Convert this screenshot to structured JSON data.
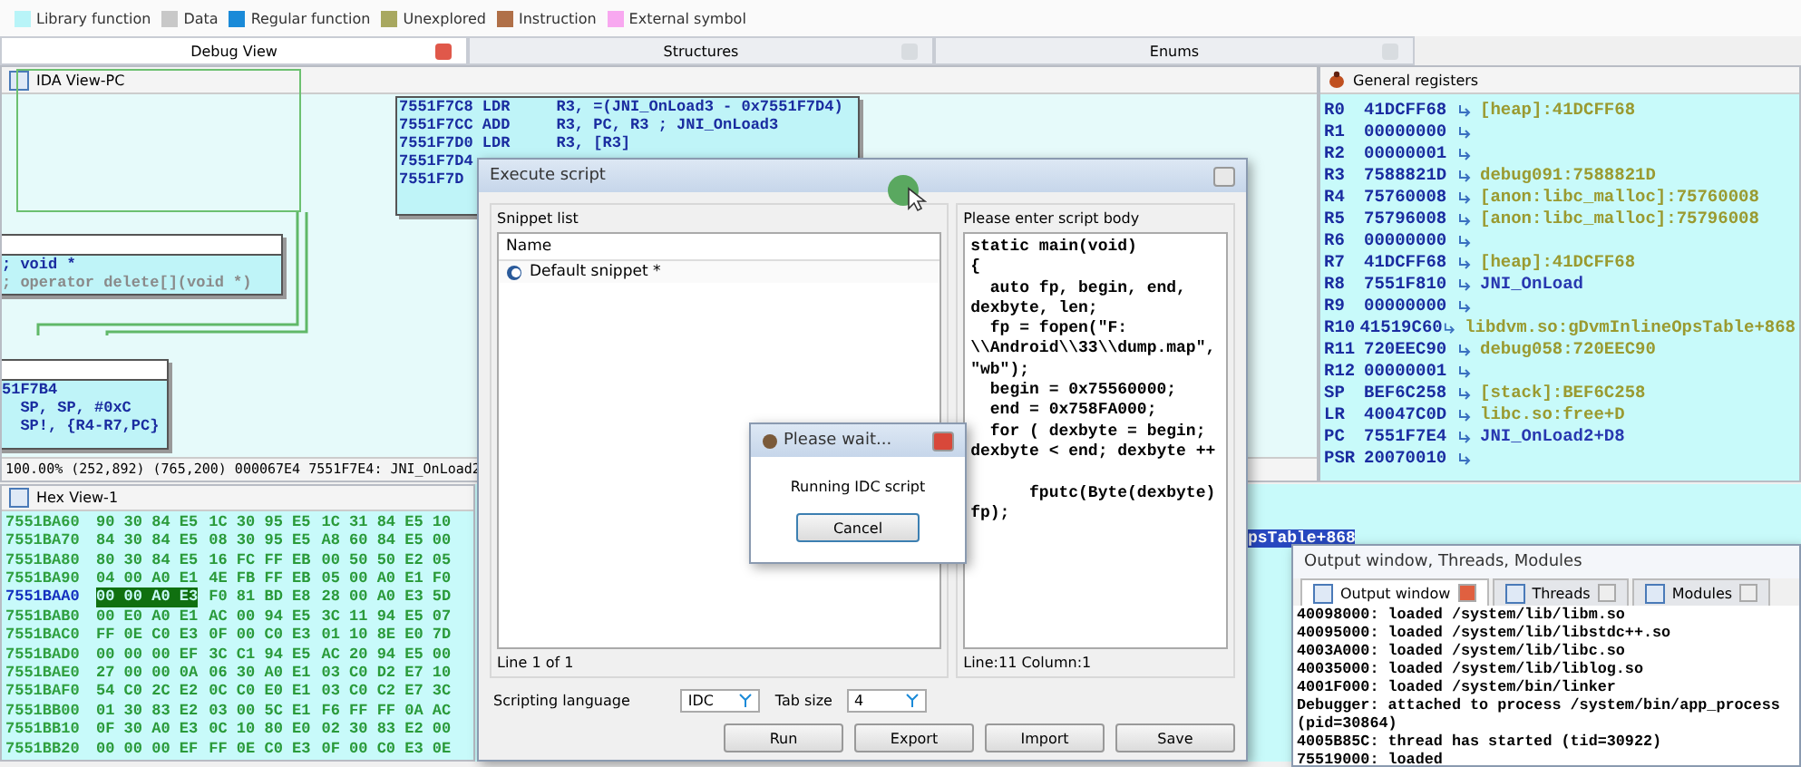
{
  "legend": [
    {
      "label": "Library function",
      "color": "#b8f4f8"
    },
    {
      "label": "Data",
      "color": "#c8c8c8"
    },
    {
      "label": "Regular function",
      "color": "#1a8ad8"
    },
    {
      "label": "Unexplored",
      "color": "#a8a860"
    },
    {
      "label": "Instruction",
      "color": "#b07048"
    },
    {
      "label": "External symbol",
      "color": "#f8a8f0"
    }
  ],
  "tabs": [
    {
      "label": "Debug View",
      "selected": true
    },
    {
      "label": "Structures",
      "selected": false
    },
    {
      "label": "Enums",
      "selected": false
    }
  ],
  "ida_view": {
    "title": "IDA View-PC",
    "nodes": [
      {
        "kind": "outline"
      },
      {
        "kind": "block",
        "lines": [
          {
            "text": "; void *",
            "kind": "code"
          },
          {
            "text": "; operator delete[](void *)",
            "kind": "comment"
          }
        ]
      },
      {
        "kind": "block",
        "lines": [
          {
            "text": "51F7B4",
            "kind": "code"
          },
          {
            "text": "  SP, SP, #0xC",
            "kind": "code"
          },
          {
            "text": "  SP!, {R4-R7,PC}",
            "kind": "code"
          }
        ]
      },
      {
        "kind": "block",
        "lines": [
          {
            "text": "7551F7C8 LDR     R3, =(JNI_OnLoad3 - 0x7551F7D4)",
            "kind": "code"
          },
          {
            "text": "7551F7CC ADD     R3, PC, R3 ; JNI_OnLoad3",
            "kind": "code"
          },
          {
            "text": "7551F7D0 LDR     R3, [R3]",
            "kind": "code"
          },
          {
            "text": "7551F7D4",
            "kind": "code"
          },
          {
            "text": "7551F7D",
            "kind": "code"
          }
        ]
      }
    ],
    "status": "100.00% (252,892) (765,200) 000067E4 7551F7E4: JNI_OnLoad2"
  },
  "registers": {
    "title": "General registers",
    "rows": [
      {
        "name": "R0",
        "value": "41DCFF68",
        "target": "[heap]:41DCFF68",
        "kind": "data"
      },
      {
        "name": "R1",
        "value": "00000000"
      },
      {
        "name": "R2",
        "value": "00000001"
      },
      {
        "name": "R3",
        "value": "7588821D",
        "target": "debug091:7588821D",
        "kind": "data"
      },
      {
        "name": "R4",
        "value": "75760008",
        "target": "[anon:libc_malloc]:75760008",
        "kind": "data"
      },
      {
        "name": "R5",
        "value": "75796008",
        "target": "[anon:libc_malloc]:75796008",
        "kind": "data"
      },
      {
        "name": "R6",
        "value": "00000000"
      },
      {
        "name": "R7",
        "value": "41DCFF68",
        "target": "[heap]:41DCFF68",
        "kind": "data"
      },
      {
        "name": "R8",
        "value": "7551F810",
        "target": "JNI_OnLoad",
        "kind": "code"
      },
      {
        "name": "R9",
        "value": "00000000"
      },
      {
        "name": "R10",
        "value": "41519C60",
        "target": "libdvm.so:gDvmInlineOpsTable+868",
        "kind": "data"
      },
      {
        "name": "R11",
        "value": "720EEC90",
        "target": "debug058:720EEC90",
        "kind": "data"
      },
      {
        "name": "R12",
        "value": "00000001"
      },
      {
        "name": "SP",
        "value": "BEF6C258",
        "target": "[stack]:BEF6C258",
        "kind": "data"
      },
      {
        "name": "LR",
        "value": "40047C0D",
        "target": "libc.so:free+D",
        "kind": "data"
      },
      {
        "name": "PC",
        "value": "7551F7E4",
        "target": "JNI_OnLoad2+D8",
        "kind": "code"
      },
      {
        "name": "PSR",
        "value": "20070010"
      }
    ]
  },
  "hex_view": {
    "title": "Hex View-1",
    "rows": [
      {
        "address": "7551BA60",
        "groups": [
          "90 30 84 E5",
          "1C 30 95 E5",
          "1C 31 84 E5 10"
        ],
        "selected": false
      },
      {
        "address": "7551BA70",
        "groups": [
          "84 30 84 E5",
          "08 30 95 E5",
          "A8 60 84 E5 00"
        ],
        "selected": false
      },
      {
        "address": "7551BA80",
        "groups": [
          "80 30 84 E5",
          "16 FC FF EB",
          "00 50 50 E2 05"
        ],
        "selected": false
      },
      {
        "address": "7551BA90",
        "groups": [
          "04 00 A0 E1",
          "4E FB FF EB",
          "05 00 A0 E1 F0"
        ],
        "selected": false
      },
      {
        "address": "7551BAA0",
        "groups": [
          "00 00 A0 E3",
          "F0 81 BD E8",
          "28 00 A0 E3 5D"
        ],
        "selected": true
      },
      {
        "address": "7551BAB0",
        "groups": [
          "00 E0 A0 E1",
          "AC 00 94 E5",
          "3C 11 94 E5 07"
        ],
        "selected": false
      },
      {
        "address": "7551BAC0",
        "groups": [
          "FF 0E C0 E3",
          "0F 00 C0 E3",
          "01 10 8E E0 7D"
        ],
        "selected": false
      },
      {
        "address": "7551BAD0",
        "groups": [
          "00 00 00 EF",
          "3C C1 94 E5",
          "AC 20 94 E5 00"
        ],
        "selected": false
      },
      {
        "address": "7551BAE0",
        "groups": [
          "27 00 00 0A",
          "06 30 A0 E1",
          "03 C0 D2 E7 10"
        ],
        "selected": false
      },
      {
        "address": "7551BAF0",
        "groups": [
          "54 C0 2C E2",
          "0C C0 E0 E1",
          "03 C0 C2 E7 3C"
        ],
        "selected": false
      },
      {
        "address": "7551BB00",
        "groups": [
          "01 30 83 E2",
          "03 00 5C E1",
          "F6 FF FF 0A AC"
        ],
        "selected": false
      },
      {
        "address": "7551BB10",
        "groups": [
          "0F 30 A0 E3",
          "0C 10 80 E0",
          "02 30 83 E2 00"
        ],
        "selected": false
      },
      {
        "address": "7551BB20",
        "groups": [
          "00 00 00 EF",
          "FF 0E C0 E3",
          "0F 00 C0 E3 0E"
        ],
        "selected": false
      }
    ]
  },
  "stack_view": {
    "text": "psTable+868"
  },
  "execute_script": {
    "title": "Execute script",
    "snippets": {
      "label": "Snippet list",
      "column": "Name",
      "items": [
        {
          "label": "Default snippet *",
          "selected": false
        }
      ],
      "status": "Line 1 of 1"
    },
    "script": {
      "label": "Please enter script body",
      "lines": [
        {
          "text": "static main(void)"
        },
        {
          "text": "{"
        },
        {
          "text": "  auto fp, begin, end,"
        },
        {
          "text": "dexbyte, len;"
        },
        {
          "text": "  fp = fopen(\"F:"
        },
        {
          "text": "\\\\Android\\\\33\\\\dump.map\","
        },
        {
          "text": "\"wb\");"
        },
        {
          "text": "  begin = 0x75560000;"
        },
        {
          "text": "  end = 0x758FA000;"
        },
        {
          "text": "  for ( dexbyte = begin;"
        },
        {
          "text": "dexbyte < end; dexbyte ++"
        },
        {
          "text": "      fputc(Byte(dexbyte)",
          "blank_before": true
        },
        {
          "text": "fp);"
        }
      ],
      "status": "Line:11 Column:1"
    },
    "language": {
      "label": "Scripting language",
      "value": "IDC"
    },
    "tab_size": {
      "label": "Tab size",
      "value": "4"
    },
    "buttons": [
      "Run",
      "Export",
      "Import",
      "Save"
    ]
  },
  "please_wait": {
    "title": "Please wait...",
    "message": "Running IDC script",
    "button": "Cancel"
  },
  "output": {
    "title": "Output window, Threads, Modules",
    "tabs": [
      {
        "label": "Output window",
        "selected": true
      },
      {
        "label": "Threads",
        "selected": false
      },
      {
        "label": "Modules",
        "selected": false
      }
    ],
    "lines": [
      "40098000: loaded /system/lib/libm.so",
      "40095000: loaded /system/lib/libstdc++.so",
      "4003A000: loaded /system/lib/libc.so",
      "40035000: loaded /system/lib/liblog.so",
      "4001F000: loaded /system/bin/linker",
      "Debugger: attached to process /system/bin/app_process",
      "(pid=30864)",
      "4005B85C: thread has started (tid=30922)",
      "75519000: loaded"
    ]
  }
}
